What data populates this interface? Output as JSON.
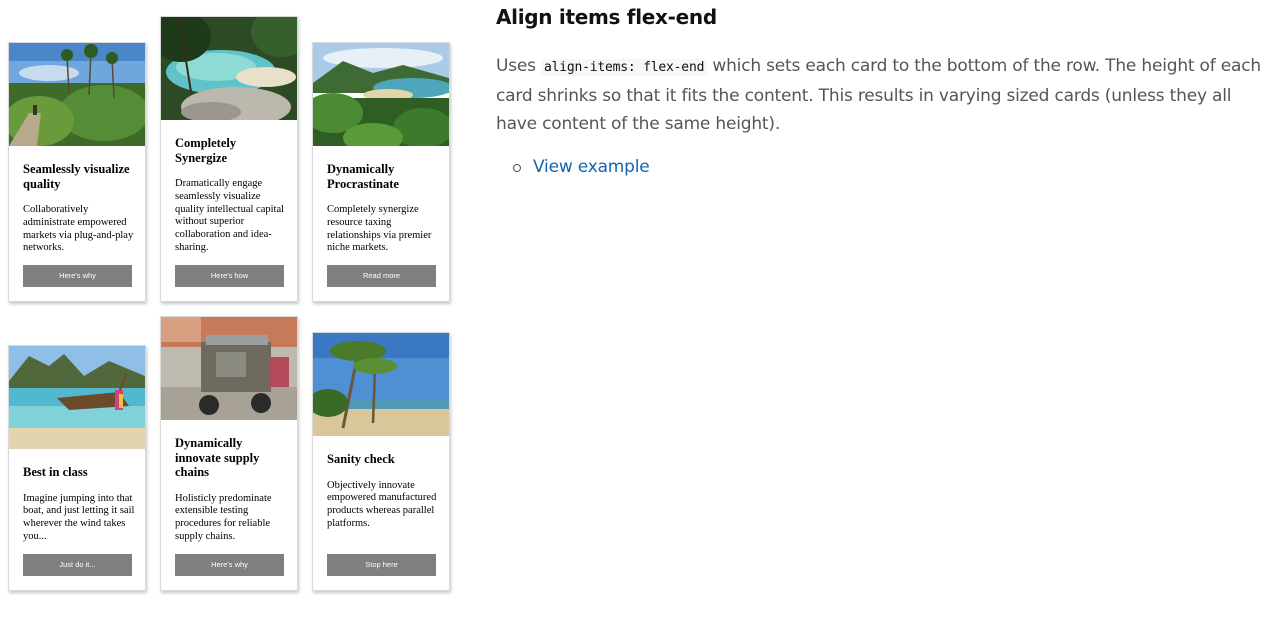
{
  "doc": {
    "heading": "Align items flex-end",
    "para_before": "Uses ",
    "code": "align-items: flex-end",
    "para_after": " which sets each card to the bottom of the row. The height of each card shrinks so that it fits the content. This results in varying sized cards (unless they all have content of the same height).",
    "link_label": "View example"
  },
  "cards": [
    {
      "title": "Seamlessly visualize quality",
      "description": "Collaboratively administrate empowered markets via plug-and-play networks.",
      "button": "Here's why",
      "image": "jungle-trail-photo"
    },
    {
      "title": "Completely Synergize",
      "description": "Dramatically engage seamlessly visualize quality intellectual capital without superior collaboration and idea-sharing.",
      "button": "Here's how",
      "image": "lagoon-rocks-photo"
    },
    {
      "title": "Dynamically Procrastinate",
      "description": "Completely synergize resource taxing relationships via premier niche markets.",
      "button": "Read more",
      "image": "bay-beach-photo"
    },
    {
      "title": "Best in class",
      "description": "Imagine jumping into that boat, and just letting it sail wherever the wind takes you...",
      "button": "Just do it...",
      "image": "longtail-boat-photo"
    },
    {
      "title": "Dynamically innovate supply chains",
      "description": "Holisticly predominate extensible testing procedures for reliable supply chains.",
      "button": "Here's why",
      "image": "tuk-tuk-photo"
    },
    {
      "title": "Sanity check",
      "description": "Objectively innovate empowered manufactured products whereas parallel platforms.",
      "button": "Stop here",
      "image": "palm-beach-photo"
    }
  ]
}
